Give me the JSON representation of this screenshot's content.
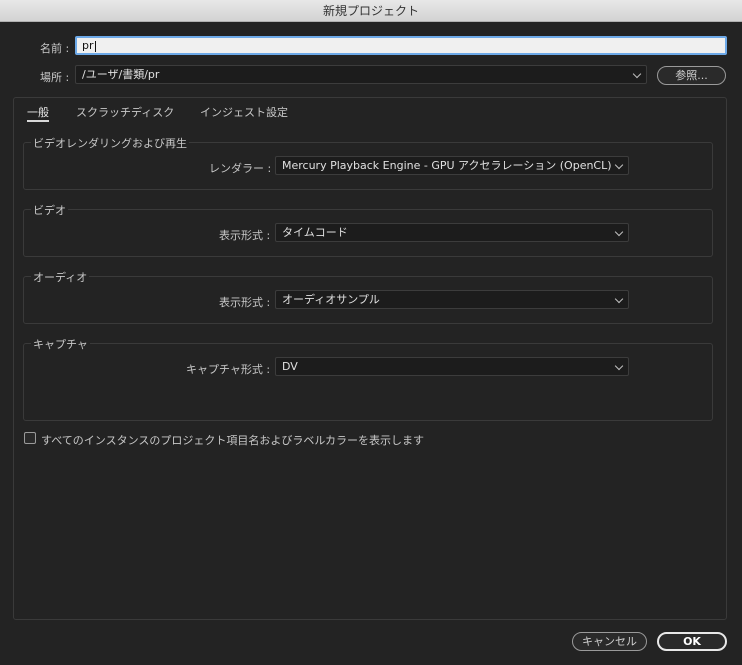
{
  "window": {
    "title": "新規プロジェクト"
  },
  "name": {
    "label": "名前 :",
    "value": "pr"
  },
  "location": {
    "label": "場所 :",
    "value": "/ユーザ/書類/pr",
    "browse_label": "参照..."
  },
  "tabs": [
    {
      "label": "一般",
      "active": true
    },
    {
      "label": "スクラッチディスク",
      "active": false
    },
    {
      "label": "インジェスト設定",
      "active": false
    }
  ],
  "groups": {
    "rendering": {
      "title": "ビデオレンダリングおよび再生",
      "field_label": "レンダラー :",
      "value": "Mercury Playback Engine - GPU アクセラレーション (OpenCL)"
    },
    "video": {
      "title": "ビデオ",
      "field_label": "表示形式 :",
      "value": "タイムコード"
    },
    "audio": {
      "title": "オーディオ",
      "field_label": "表示形式 :",
      "value": "オーディオサンプル"
    },
    "capture": {
      "title": "キャプチャ",
      "field_label": "キャプチャ形式 :",
      "value": "DV"
    }
  },
  "checkbox": {
    "label": "すべてのインスタンスのプロジェクト項目名およびラベルカラーを表示します",
    "checked": false
  },
  "footer": {
    "cancel_label": "キャンセル",
    "ok_label": "OK"
  }
}
